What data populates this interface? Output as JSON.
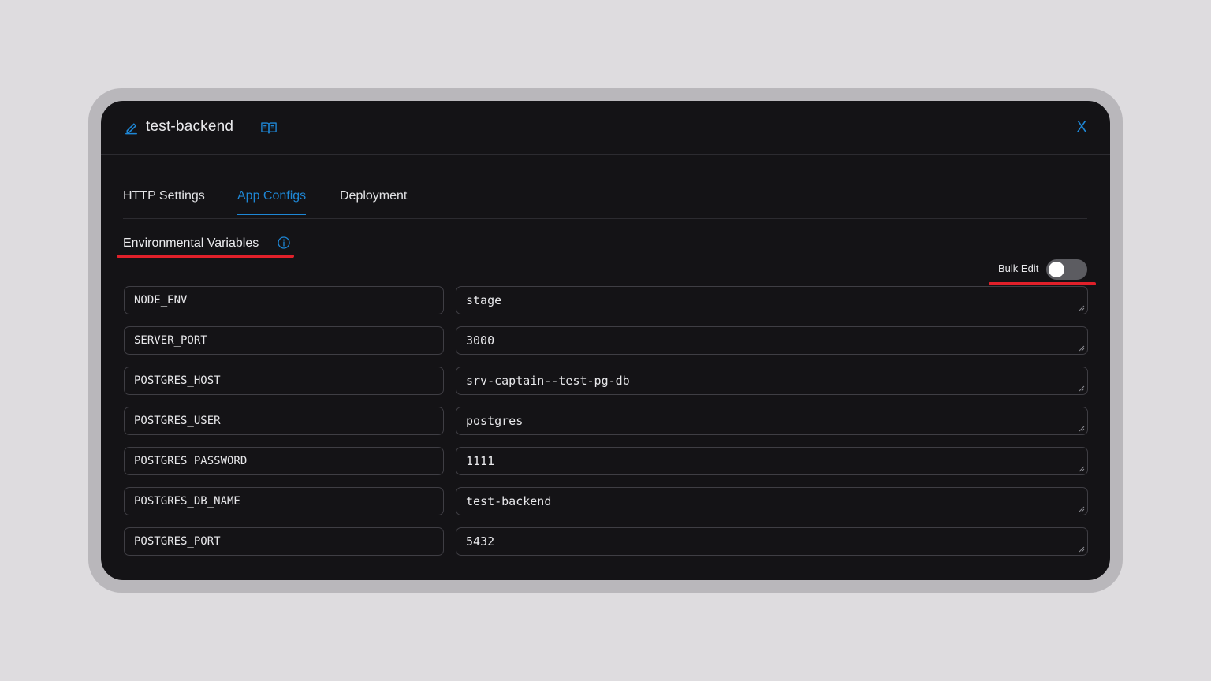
{
  "app": {
    "title": "test-backend"
  },
  "icons": {
    "edit": "pencil-edit-icon",
    "docs": "open-book-icon",
    "close": "close-icon",
    "info": "info-circle-icon"
  },
  "close_label": "X",
  "tabs": [
    {
      "label": "HTTP Settings",
      "active": false
    },
    {
      "label": "App Configs",
      "active": true
    },
    {
      "label": "Deployment",
      "active": false
    }
  ],
  "env_section": {
    "title": "Environmental Variables",
    "bulk_edit_label": "Bulk Edit",
    "bulk_edit_on": false
  },
  "env_vars": [
    {
      "key": "NODE_ENV",
      "value": "stage"
    },
    {
      "key": "SERVER_PORT",
      "value": "3000"
    },
    {
      "key": "POSTGRES_HOST",
      "value": "srv-captain--test-pg-db"
    },
    {
      "key": "POSTGRES_USER",
      "value": "postgres"
    },
    {
      "key": "POSTGRES_PASSWORD",
      "value": "1111"
    },
    {
      "key": "POSTGRES_DB_NAME",
      "value": "test-backend"
    },
    {
      "key": "POSTGRES_PORT",
      "value": "5432"
    }
  ],
  "colors": {
    "accent": "#1e87d6",
    "highlight": "#e0202a",
    "background": "#141316"
  }
}
